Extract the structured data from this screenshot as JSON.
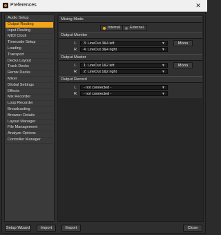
{
  "window": {
    "title": "Preferences",
    "close_glyph": "✕"
  },
  "sidebar": {
    "items": [
      {
        "label": "Audio Setup"
      },
      {
        "label": "Output Routing"
      },
      {
        "label": "Input Routing"
      },
      {
        "label": "MIDI Clock"
      },
      {
        "label": "Timecode Setup"
      },
      {
        "label": "Loading"
      },
      {
        "label": "Transport"
      },
      {
        "label": "Decks Layout"
      },
      {
        "label": "Track Decks"
      },
      {
        "label": "Remix Decks"
      },
      {
        "label": "Mixer"
      },
      {
        "label": "Global Settings"
      },
      {
        "label": "Effects"
      },
      {
        "label": "Mix Recorder"
      },
      {
        "label": "Loop Recorder"
      },
      {
        "label": "Broadcasting"
      },
      {
        "label": "Browser Details"
      },
      {
        "label": "Layout Manager"
      },
      {
        "label": "File Management"
      },
      {
        "label": "Analyze Options"
      },
      {
        "label": "Controller Manager"
      }
    ],
    "active_index": 1,
    "active_color": "#f2a51a"
  },
  "mixing_mode": {
    "title": "Mixing Mode",
    "internal_label": "Internal",
    "external_label": "External",
    "selected": "Internal"
  },
  "output_monitor": {
    "title": "Output Monitor",
    "left_label": "L",
    "right_label": "R",
    "left_value": "3: LineOut 3&4 left",
    "right_value": "4: LineOut 3&4 right",
    "mono_label": "Mono"
  },
  "output_master": {
    "title": "Output Master",
    "left_label": "L",
    "right_label": "R",
    "left_value": "1: LineOut 1&2 left",
    "right_value": "2: LineOut 1&2 right",
    "mono_label": "Mono"
  },
  "output_record": {
    "title": "Output Record",
    "left_label": "L",
    "right_label": "R",
    "left_value": "- not connected -",
    "right_value": "- not connected -"
  },
  "buttons": {
    "setup_wizard": "Setup Wizard",
    "import": "Import",
    "export": "Export",
    "close": "Close"
  },
  "dropdown_arrow": "▼"
}
